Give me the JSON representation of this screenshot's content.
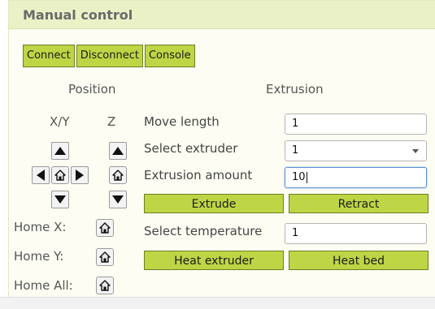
{
  "panel": {
    "title": "Manual control"
  },
  "toolbar": {
    "connect_label": "Connect",
    "disconnect_label": "Disconnect",
    "console_label": "Console"
  },
  "position": {
    "heading": "Position",
    "xy_label": "X/Y",
    "z_label": "Z",
    "home_x_label": "Home X:",
    "home_y_label": "Home Y:",
    "home_all_label": "Home All:"
  },
  "extrusion": {
    "heading": "Extrusion",
    "move_length_label": "Move length",
    "move_length_value": "1",
    "select_extruder_label": "Select extruder",
    "select_extruder_value": "1",
    "extrusion_amount_label": "Extrusion amount",
    "extrusion_amount_value": "10",
    "extrude_label": "Extrude",
    "retract_label": "Retract",
    "select_temperature_label": "Select temperature",
    "select_temperature_value": "1",
    "heat_extruder_label": "Heat extruder",
    "heat_bed_label": "Heat bed"
  },
  "icons": {
    "home": "home-icon",
    "up": "arrow-up-icon",
    "down": "arrow-down-icon",
    "left": "arrow-left-icon",
    "right": "arrow-right-icon",
    "select": "chevron-down-icon"
  },
  "colors": {
    "button_green": "#bed545",
    "header_bg": "#eaf1c7",
    "panel_bg": "#fdfdf3",
    "focus_border": "#5a8ed8"
  }
}
